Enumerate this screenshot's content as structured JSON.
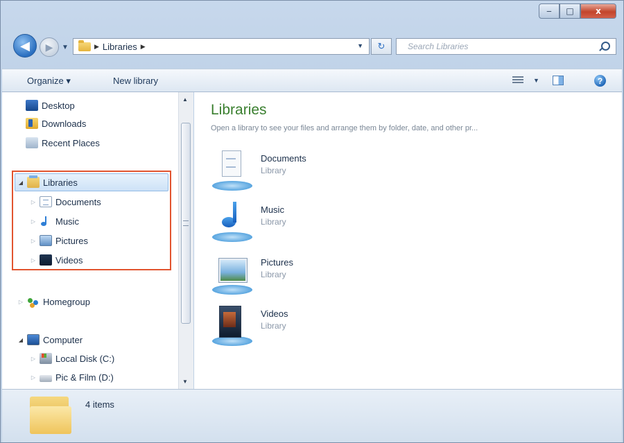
{
  "window": {
    "caption_buttons": {
      "minimize": "‒",
      "maximize": "□",
      "close": "x"
    }
  },
  "navigation": {
    "back_icon": "back-arrow-icon",
    "forward_icon": "forward-arrow-icon",
    "breadcrumb": [
      "Libraries"
    ],
    "refresh_icon": "refresh-icon",
    "search_placeholder": "Search Libraries"
  },
  "toolbar": {
    "organize": "Organize ▾",
    "new_library": "New library"
  },
  "nav_pane": {
    "favorites": [
      "Desktop",
      "Downloads",
      "Recent Places"
    ],
    "libraries_label": "Libraries",
    "libraries": [
      "Documents",
      "Music",
      "Pictures",
      "Videos"
    ],
    "homegroup": "Homegroup",
    "computer_label": "Computer",
    "drives": [
      "Local Disk (C:)",
      "Pic & Film (D:)"
    ]
  },
  "content": {
    "title": "Libraries",
    "subtitle": "Open a library to see your files and arrange them by folder, date, and other pr...",
    "items": [
      {
        "name": "Documents",
        "type": "Library"
      },
      {
        "name": "Music",
        "type": "Library"
      },
      {
        "name": "Pictures",
        "type": "Library"
      },
      {
        "name": "Videos",
        "type": "Library"
      }
    ]
  },
  "status": {
    "count": "4 items"
  },
  "colors": {
    "title_green": "#3a7f2f",
    "highlight_outline": "#e2542f",
    "chrome_blue": "#c7d8ec"
  }
}
